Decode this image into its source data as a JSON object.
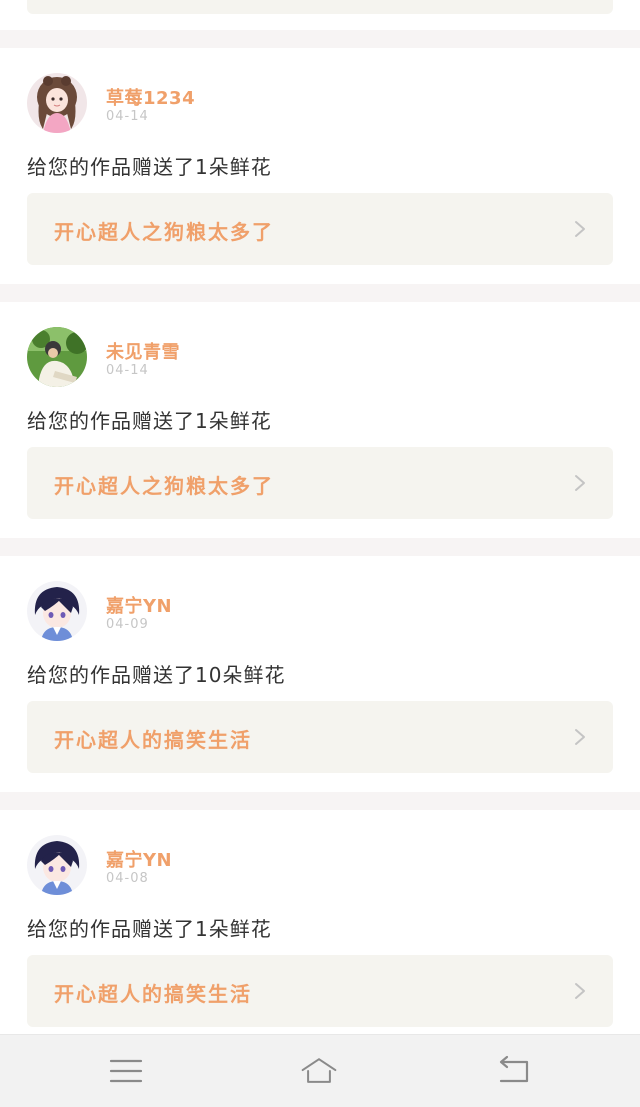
{
  "feed": {
    "items": [
      {
        "user": "草莓1234",
        "date": "04-14",
        "action": "给您的作品赠送了1朵鲜花",
        "work_title": "开心超人之狗粮太多了",
        "avatar_icon": "girl-pink-dress-avatar"
      },
      {
        "user": "未见青雪",
        "date": "04-14",
        "action": "给您的作品赠送了1朵鲜花",
        "work_title": "开心超人之狗粮太多了",
        "avatar_icon": "outdoor-photo-avatar"
      },
      {
        "user": "嘉宁YN",
        "date": "04-09",
        "action": "给您的作品赠送了10朵鲜花",
        "work_title": "开心超人的搞笑生活",
        "avatar_icon": "anime-boy-avatar"
      },
      {
        "user": "嘉宁YN",
        "date": "04-08",
        "action": "给您的作品赠送了1朵鲜花",
        "work_title": "开心超人的搞笑生活",
        "avatar_icon": "anime-boy-avatar"
      }
    ]
  },
  "navbar": {
    "menu_icon": "menu-icon",
    "home_icon": "home-icon",
    "back_icon": "back-icon"
  },
  "colors": {
    "accent": "#f0a06a",
    "card_link_bg": "#f5f4ef",
    "text": "#333333",
    "muted": "#c6c6c6"
  }
}
